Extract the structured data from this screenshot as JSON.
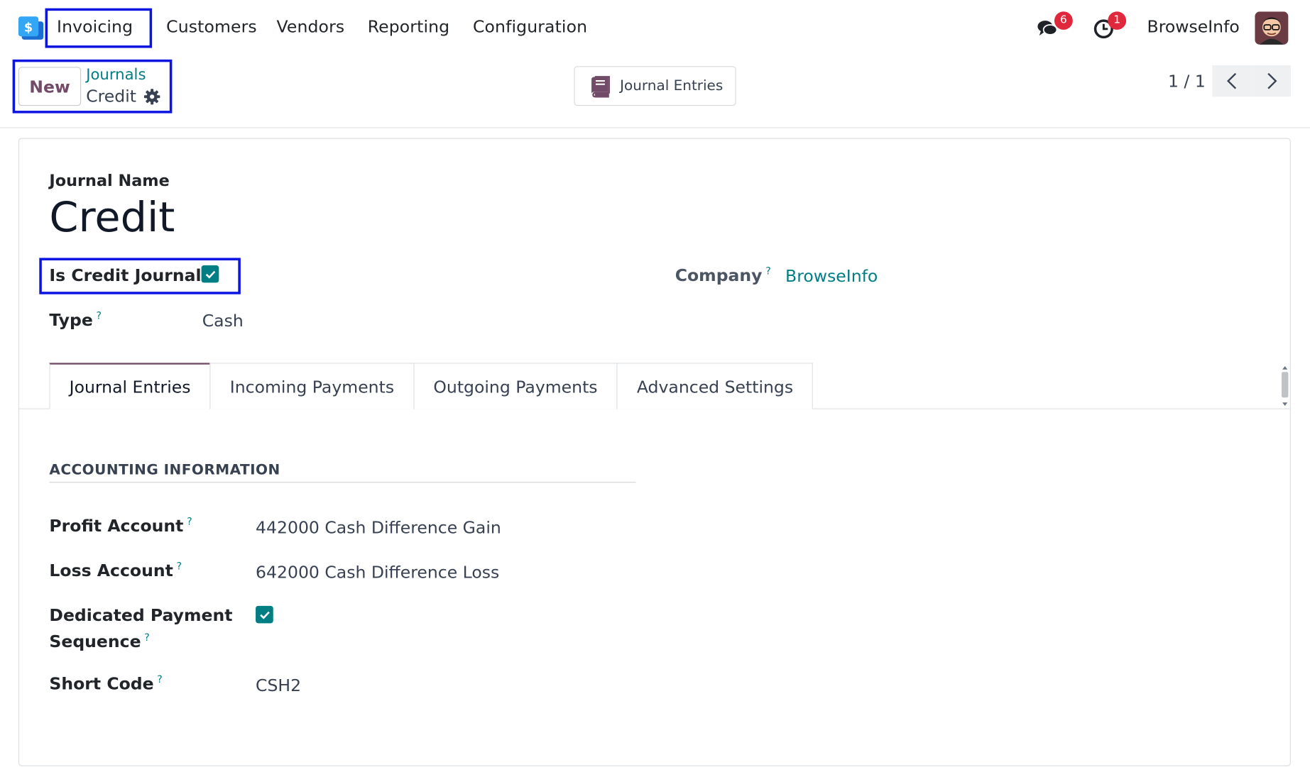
{
  "navbar": {
    "app_name": "Invoicing",
    "menu": [
      "Customers",
      "Vendors",
      "Reporting",
      "Configuration"
    ],
    "messages_count": "6",
    "activities_count": "1",
    "user_name": "BrowseInfo"
  },
  "control_panel": {
    "new_label": "New",
    "breadcrumb_parent": "Journals",
    "breadcrumb_current": "Credit",
    "smart_button_label": "Journal Entries",
    "pager": "1 / 1"
  },
  "form": {
    "journal_name_label": "Journal Name",
    "journal_name": "Credit",
    "is_credit_label": "Is Credit Journal",
    "is_credit_checked": true,
    "type_label": "Type",
    "type_help": "?",
    "type_value": "Cash",
    "company_label": "Company",
    "company_help": "?",
    "company_value": "BrowseInfo"
  },
  "tabs": [
    "Journal Entries",
    "Incoming Payments",
    "Outgoing Payments",
    "Advanced Settings"
  ],
  "active_tab": "Journal Entries",
  "accounting": {
    "section_title": "ACCOUNTING INFORMATION",
    "profit_label": "Profit Account",
    "profit_value": "442000 Cash Difference Gain",
    "loss_label": "Loss Account",
    "loss_value": "642000 Cash Difference Loss",
    "dedicated_label_1": "Dedicated Payment",
    "dedicated_label_2": "Sequence",
    "dedicated_checked": true,
    "short_code_label": "Short Code",
    "short_code_value": "CSH2",
    "help_mark": "?"
  },
  "colors": {
    "brand": "#714b67",
    "accent": "#017e84",
    "badge": "#e0283c",
    "highlight": "#0b14e0"
  }
}
